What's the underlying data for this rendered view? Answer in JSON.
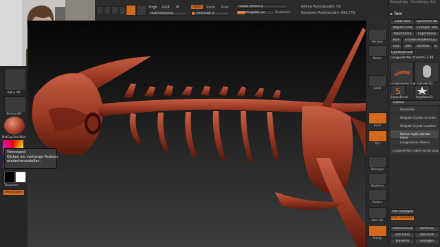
{
  "top_bar": {
    "mrgb": "Mrgb",
    "rgb": "RGB",
    "m": "M",
    "rgb_intensity": "RGB Intensität",
    "zadd": "Zadd",
    "zsub": "Zsub",
    "zcut": "Zcut",
    "z_intensity": "Z Intensität 3",
    "focal_shift": "Fokale Versch 0",
    "draw_size": "Zeichengröße 22",
    "dynamic": "Dynamisch",
    "active_points": "Aktive Punktanzahl: 56",
    "total_points": "Gesamte Punktanzahl: 690,772"
  },
  "title_right": {
    "undo": "Rückgängig",
    "undo_history": "Rückgängig Hist"
  },
  "left_panel": {
    "alpha_label": "Alpha Off",
    "texture_label": "Texture Off",
    "material_label": "MatCap Red Wax",
    "swatch_label": "Tauschen",
    "switch_color": "Umschalten"
  },
  "tooltip": {
    "line1": "Trennwand",
    "line2": "Klicken um vorherige Position",
    "line3": "wiederherzustellen."
  },
  "right_shelf": {
    "items": [
      "Perspek",
      "Boden",
      "Lokal",
      "Lsym",
      "Xyz",
      "Bewegen",
      "Skalieren",
      "Drehen",
      "Linie füll",
      "Transp"
    ]
  },
  "palette": {
    "header": "Tool",
    "buttons": [
      "Lade Tool",
      "Speichern als",
      "Kopiere Tool",
      "Einfügen Tool",
      "Importieren",
      "Exportieren",
      "Klon",
      "Erstelle PolyMesh3D",
      "GoZ",
      "Alle",
      "Sichtbar",
      "R"
    ],
    "lightbox": "Lightbox▸Tools",
    "current_tool": "Langpoliertes Anatomi.3 48",
    "subtool_header": "Subtool",
    "subtools": [
      "Oberkiefer",
      "Obligate Goyote cerradeln",
      "Obligate Goyote cavadeln",
      "Remus capille dorsale major",
      "Langpoliertes Albercs",
      "Langpoliertes Capille dorsal Lung"
    ],
    "sculpt_thumbs": [
      "Langpoliertes Cap",
      "Cylinder3D",
      "SimpleBrush",
      "PolyMesh3D",
      "Langpoliertes Cap"
    ],
    "bottom_buttons": [
      "Alle anzeigen",
      "Auto Schließen",
      "Umbenennen",
      "Sortieren",
      "Alle klein",
      "Alle hoch",
      "Kopieren",
      "Einfügen"
    ]
  }
}
